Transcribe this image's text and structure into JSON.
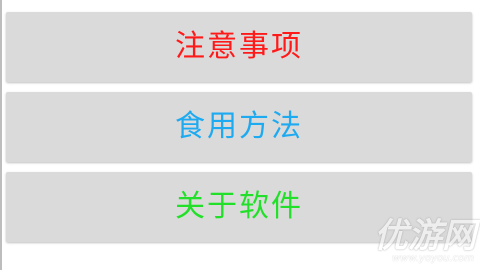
{
  "menu": {
    "items": [
      {
        "label": "注意事项",
        "color": "#ff1a1a"
      },
      {
        "label": "食用方法",
        "color": "#1eaaf1"
      },
      {
        "label": "关于软件",
        "color": "#22e02a"
      }
    ]
  },
  "watermark": {
    "text": "优游网",
    "sub": "www.yoyou.com"
  }
}
